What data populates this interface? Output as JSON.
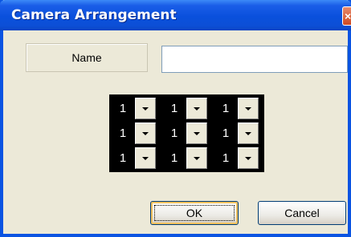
{
  "window": {
    "title": "Camera Arrangement",
    "close_glyph": "×"
  },
  "form": {
    "name_label": "Name",
    "name_value": ""
  },
  "grid": {
    "rows": [
      [
        "1",
        "1",
        "1"
      ],
      [
        "1",
        "1",
        "1"
      ],
      [
        "1",
        "1",
        "1"
      ]
    ]
  },
  "buttons": {
    "ok": "OK",
    "cancel": "Cancel"
  }
}
